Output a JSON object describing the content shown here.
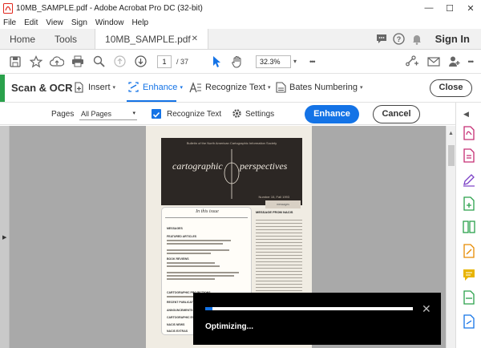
{
  "window": {
    "title": "10MB_SAMPLE.pdf - Adobe Acrobat Pro DC (32-bit)",
    "controls": {
      "minimize": "—",
      "maximize": "☐",
      "close": "✕"
    }
  },
  "menu": {
    "items": [
      "File",
      "Edit",
      "View",
      "Sign",
      "Window",
      "Help"
    ]
  },
  "tabs": {
    "home": "Home",
    "tools": "Tools",
    "document": "10MB_SAMPLE.pdf",
    "document_close": "✕",
    "sign_in": "Sign In"
  },
  "toolbar": {
    "current_page": "1",
    "page_total": "/ 37",
    "zoom": "32.3%",
    "zoom_caret": "▾",
    "more": "•••",
    "more_right": "•••"
  },
  "scan_ocr": {
    "title": "Scan & OCR",
    "insert": "Insert",
    "enhance": "Enhance",
    "recognize_text": "Recognize Text",
    "bates_numbering": "Bates Numbering",
    "close": "Close"
  },
  "options": {
    "pages_label": "Pages",
    "pages_value": "All Pages",
    "recognize_text_checkbox": "Recognize Text",
    "recognize_text_checked": true,
    "settings": "Settings",
    "enhance_button": "Enhance",
    "cancel_button": "Cancel"
  },
  "document": {
    "cover_top": "Bulletin of the North American Cartographic Information Society",
    "cover_title_left": "cartographic",
    "cover_title_right": "perspectives",
    "cover_number": "Number 15, Fall 1993",
    "issue_header": "In this issue",
    "issue_items": [
      "MESSAGES",
      "FEATURED ARTICLES",
      "BOOK REVIEWS",
      "CARTOGRAPHIC PROJECTIONS",
      "RECENT PUBLICATIONS",
      "ANNOUNCEMENTS",
      "CARTOGRAPHIC EVENTS",
      "NACIS NEWS",
      "NACIS EXTRAS"
    ],
    "col2_caption": "MESSAGE FROM NACIS",
    "cover_tag": "messages"
  },
  "progress": {
    "label": "Optimizing...",
    "fraction": 0.035,
    "close": "✕"
  },
  "colors": {
    "accent": "#1473e6",
    "scan_accent": "#2aa14b",
    "acrobat_red": "#e0261c"
  }
}
